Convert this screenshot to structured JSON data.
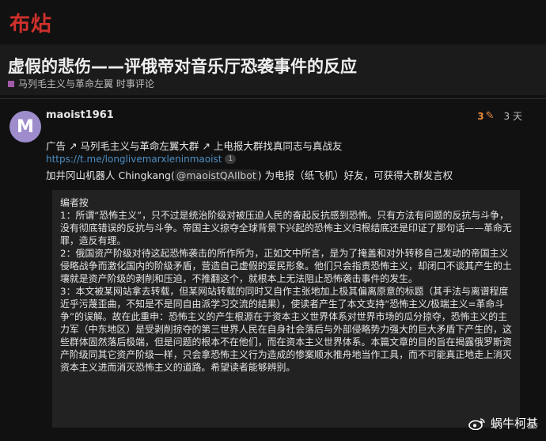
{
  "site": {
    "logo_text": "布炶"
  },
  "topic": {
    "title": "虚假的悲伤——评俄帝对音乐厅恐袭事件的反应",
    "category": "马列毛主义与革命左翼 时事评论",
    "category_color": "#a05aa8"
  },
  "post": {
    "avatar_letter": "M",
    "avatar_color": "#9e8ccc",
    "username": "maoist1961",
    "edit_count": "3",
    "age": "3 天",
    "ad_line": "广告 ↗ 马列毛主义与革命左翼大群 ↗ 上电报大群找真同志与真战友",
    "link": "https://t.me/longlivemarxleninmaoist",
    "link_clicks": "1",
    "bot_prefix": "加井冈山机器人 Chingkang(",
    "bot_mention": "@maoistQAIlbot",
    "bot_suffix": ") 为电报（纸飞机）好友，可获得大群发言权"
  },
  "quote": {
    "heading": "编者按",
    "paragraphs": [
      "1：所谓“恐怖主义”，只不过是统治阶级对被压迫人民的奋起反抗感到恐怖。只有方法有问题的反抗与斗争，没有彻底错误的反抗与斗争。帝国主义掠夺全球背景下兴起的恐怖主义归根结底还是印证了那句话——革命无罪，造反有理。",
      "2：俄国资产阶级对待这起恐怖袭击的所作所为，正如文中所言，是为了掩盖和对外转移自己发动的帝国主义侵略战争而激化国内的阶级矛盾，营造自己虚假的爱民形象。他们只会指责恐怖主义，却闭口不谈其产生的土壤就是资产阶级的剥削和压迫，不推翻这个，就根本上无法阻止恐怖袭击事件的发生。",
      "3：本文被某网站拿去转载，但某网站转载的同时又自作主张地加上极其偏离原意的标题（其手法与离谱程度近乎污蔑歪曲，不知是不是同自由派学习交流的结果），使读者产生了本文支持“恐怖主义/极端主义=革命斗争”的误解。故在此重申：恐怖主义的产生根源在于资本主义世界体系对世界市场的瓜分掠夺，恐怖主义的主力军（中东地区）是受剥削掠夺的第三世界人民在自身社会落后与外部侵略势力强大的巨大矛盾下产生的，这些群体固然落后极端，但是问题的根本不在他们，而在资本主义世界体系。本篇文章的目的旨在揭露俄罗斯资产阶级同其它资产阶级一样，只会拿恐怖主义行为造成的惨案顺水推舟地当作工具，而不可能真正地走上消灭资本主义进而消灭恐怖主义的道路。希望读者能够辨别。"
    ]
  },
  "watermark": {
    "text": "蜗牛柯基"
  },
  "colors": {
    "background": "#111111",
    "title_bar": "#1b1b1b",
    "quote_bg": "#222222",
    "link": "#4e8fc4",
    "accent_orange": "#e5893a",
    "logo_red": "#d0302c"
  },
  "icons": {
    "edit": "pencil-icon",
    "external": "external-link-icon",
    "watermark": "weibo-icon"
  }
}
